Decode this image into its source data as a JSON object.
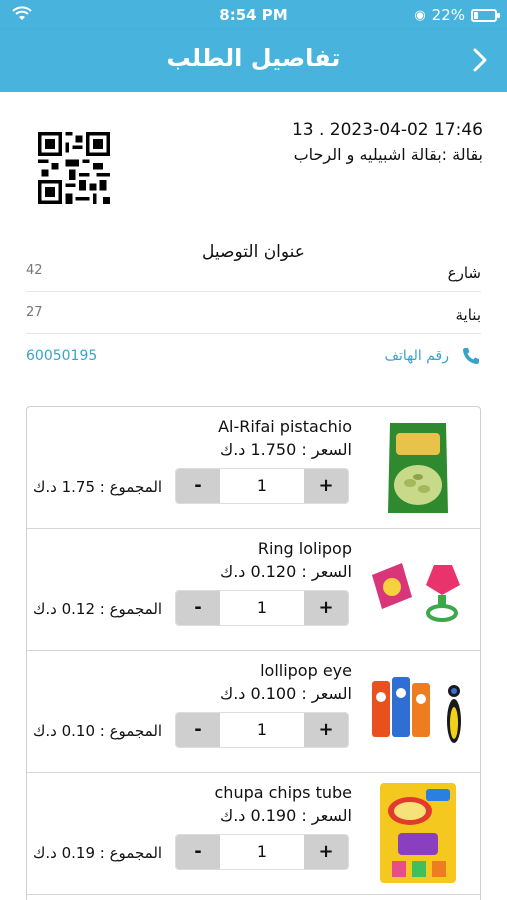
{
  "status": {
    "time": "8:54 PM",
    "battery": "22%",
    "battery_level": 0.22
  },
  "header": {
    "title": "تفاصيل الطلب"
  },
  "order": {
    "datetime": "13 . 2023-04-02 17:46",
    "store": "بقالة :بقالة اشبيليه و الرحاب"
  },
  "address": {
    "title": "عنوان التوصيل",
    "street_label": "شارع",
    "street_value": "42",
    "building_label": "بناية",
    "building_value": "27",
    "phone_label": "رقم الهاتف",
    "phone_value": "60050195"
  },
  "products": [
    {
      "name": "Al-Rifai pistachio",
      "price": "السعر : 1.750 د.ك",
      "qty": "1",
      "total": "المجموع : 1.75 د.ك",
      "minus": "-",
      "plus": "+"
    },
    {
      "name": "Ring lolipop",
      "price": "السعر : 0.120 د.ك",
      "qty": "1",
      "total": "المجموع : 0.12 د.ك",
      "minus": "-",
      "plus": "+"
    },
    {
      "name": "lollipop eye",
      "price": "السعر : 0.100 د.ك",
      "qty": "1",
      "total": "المجموع : 0.10 د.ك",
      "minus": "-",
      "plus": "+"
    },
    {
      "name": "chupa chips tube",
      "price": "السعر : 0.190 د.ك",
      "qty": "1",
      "total": "المجموع : 0.19 د.ك",
      "minus": "-",
      "plus": "+"
    }
  ],
  "colors": {
    "accent": "#48b3dc",
    "link": "#3aa3cc"
  },
  "icons": {
    "back": "chevron-right-icon",
    "phone": "phone-icon",
    "wifi": "wifi-icon",
    "qr": "qr-code"
  }
}
